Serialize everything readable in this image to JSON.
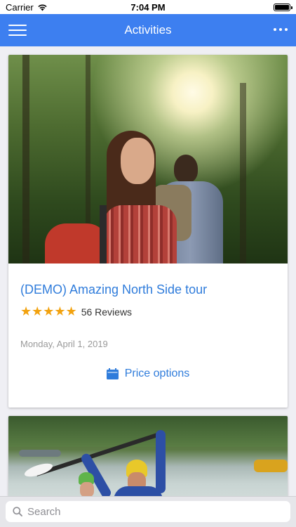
{
  "status_bar": {
    "carrier": "Carrier",
    "time": "7:04 PM",
    "battery_level": 1.0
  },
  "nav": {
    "title": "Activities"
  },
  "activities": [
    {
      "title": "(DEMO) Amazing North Side tour",
      "rating": 5,
      "stars": "★★★★★",
      "reviews": "56 Reviews",
      "date": "Monday, April 1, 2019",
      "price_label": "Price options"
    }
  ],
  "search": {
    "placeholder": "Search"
  },
  "colors": {
    "accent": "#3d7ff0",
    "link": "#2f7cdb",
    "star": "#f2a20f"
  },
  "icons": [
    "wifi-icon",
    "battery-icon",
    "hamburger-menu-icon",
    "more-options-icon",
    "calendar-icon",
    "search-icon"
  ]
}
